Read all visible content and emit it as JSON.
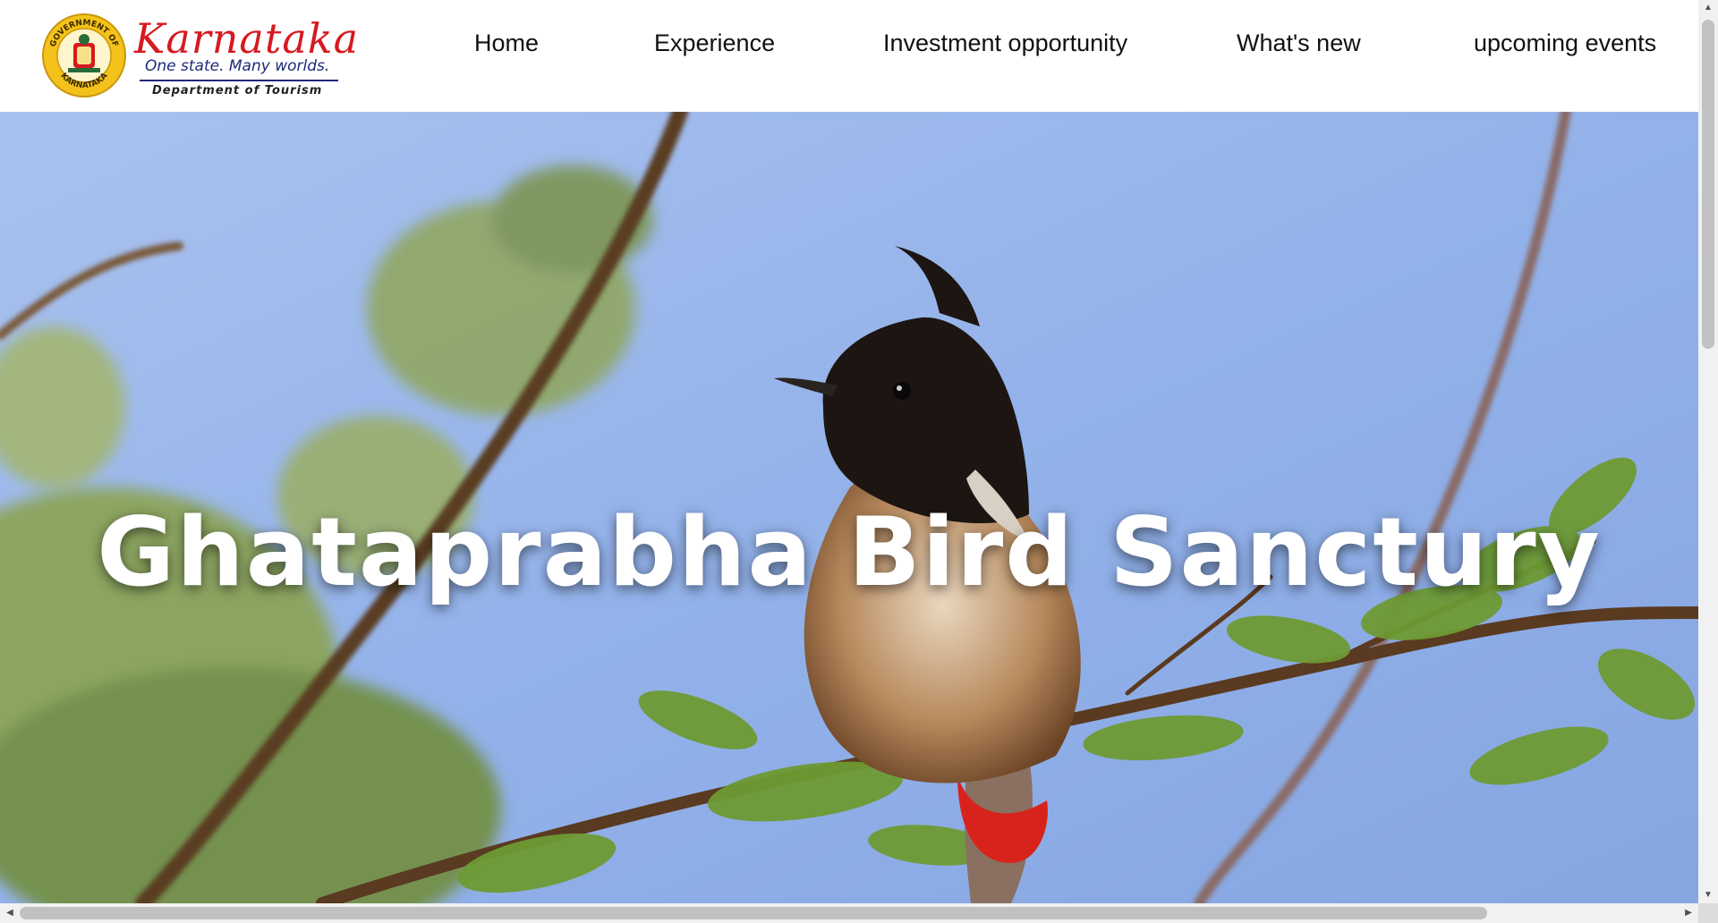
{
  "brand": {
    "seal_top_text": "GOVERNMENT OF",
    "seal_bottom_text": "KARNATAKA",
    "name": "Karnataka",
    "tagline": "One state. Many worlds.",
    "department": "Department of Tourism"
  },
  "nav": {
    "items": [
      {
        "label": "Home"
      },
      {
        "label": "Experience"
      },
      {
        "label": "Investment opportunity"
      },
      {
        "label": "What's new"
      },
      {
        "label": "upcoming events"
      }
    ]
  },
  "hero": {
    "title": "Ghataprabha Bird Sanctury",
    "image": "red-vented-bulbul-on-acacia-branch"
  },
  "scrollbars": {
    "up": "▲",
    "down": "▼",
    "left": "◀",
    "right": "▶"
  },
  "colors": {
    "brand_red": "#d71920",
    "brand_blue": "#1e2a78",
    "sky": "#8fb0e8",
    "foliage": "#7a9a3a"
  }
}
